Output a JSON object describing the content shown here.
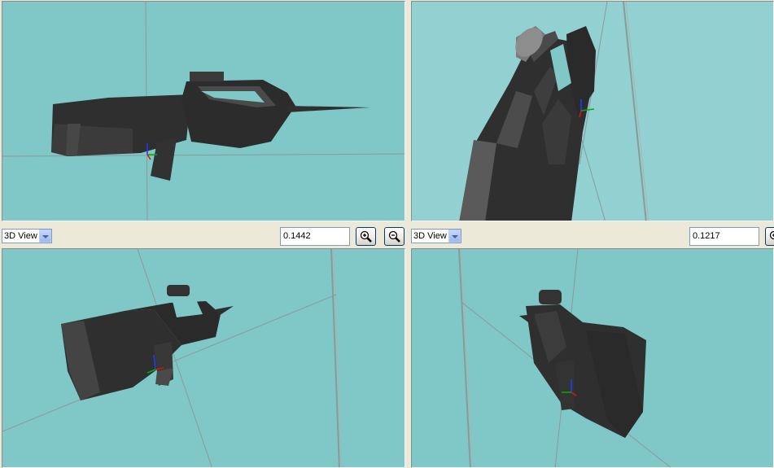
{
  "colors": {
    "viewport_bg": "#80c7c7",
    "model": "#2f2f2f",
    "grid_line": "#8a9a9a"
  },
  "viewports": [
    {
      "id": "top-left"
    },
    {
      "id": "top-right"
    },
    {
      "id": "bottom-left"
    },
    {
      "id": "bottom-right"
    }
  ],
  "toolbars": [
    {
      "view_select": "3D View",
      "zoom_value": "0.1442",
      "zoom_in_icon": "zoom-in-icon",
      "zoom_out_icon": "zoom-out-icon"
    },
    {
      "view_select": "3D View",
      "zoom_value": "0.1217",
      "zoom_in_icon": "zoom-in-icon"
    }
  ]
}
